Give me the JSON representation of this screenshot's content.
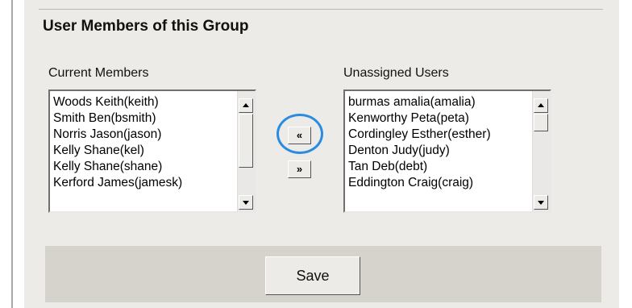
{
  "section": {
    "title": "User Members of this Group"
  },
  "current_members": {
    "label": "Current Members",
    "items": [
      "Woods Keith(keith)",
      "Smith Ben(bsmith)",
      "Norris Jason(jason)",
      "Kelly Shane(kel)",
      "Kelly Shane(shane)",
      "Kerford James(jamesk)"
    ]
  },
  "unassigned_users": {
    "label": "Unassigned Users",
    "items": [
      "burmas amalia(amalia)",
      "Kenworthy Peta(peta)",
      "Cordingley Esther(esther)",
      "Denton Judy(judy)",
      "Tan Deb(debt)",
      "Eddington Craig(craig)"
    ]
  },
  "transfer": {
    "add_label": "«",
    "remove_label": "»"
  },
  "actions": {
    "save_label": "Save"
  },
  "colors": {
    "panel": "#ecebe8",
    "save_bar": "#d6d3cc",
    "highlight": "#2a8ce0"
  }
}
